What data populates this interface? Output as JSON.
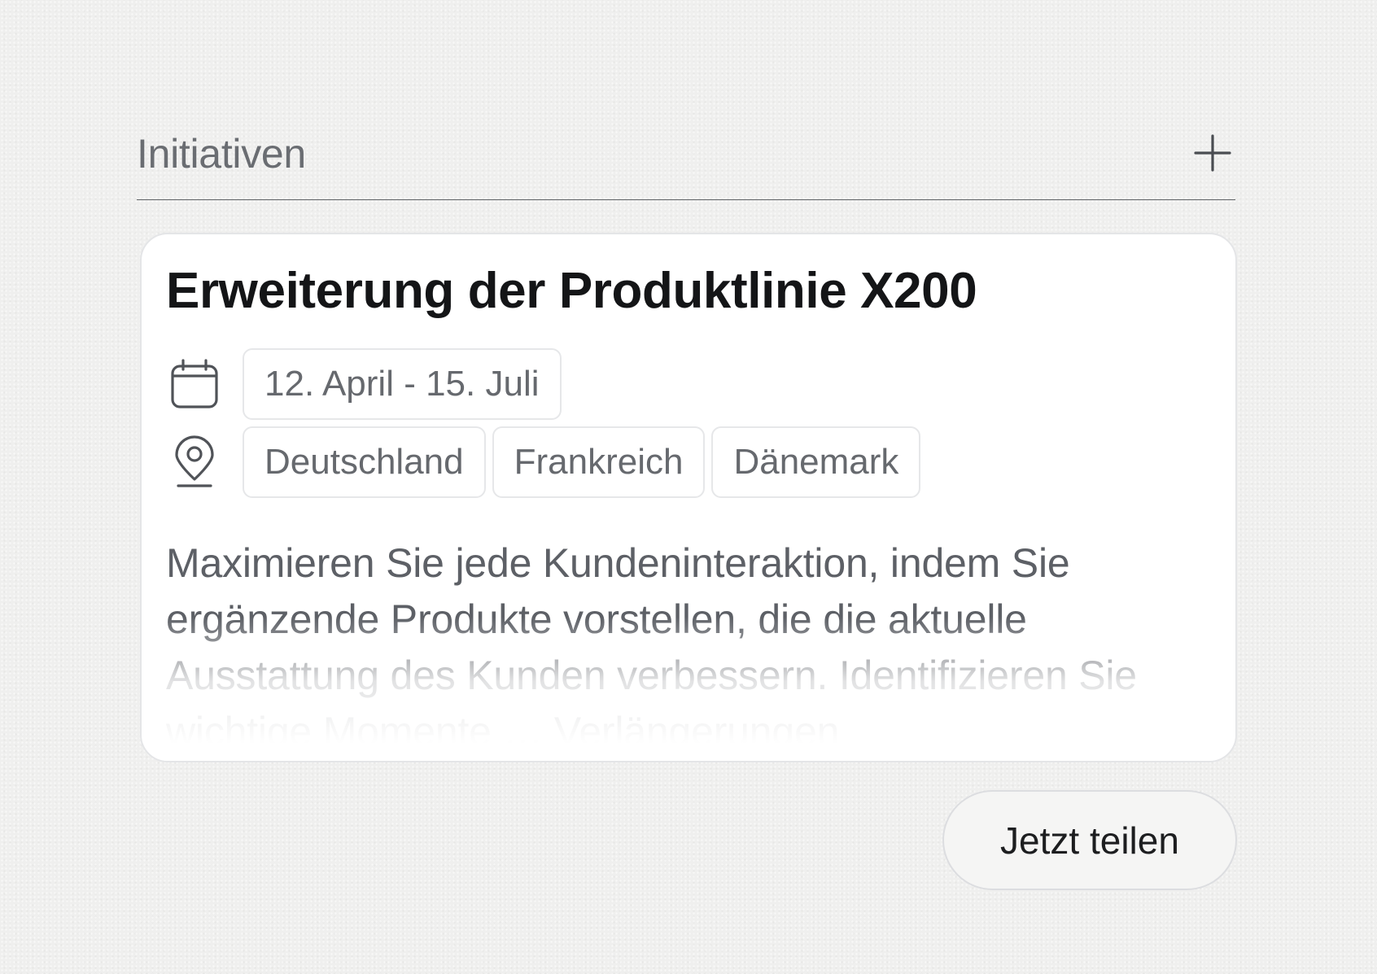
{
  "section": {
    "title": "Initiativen",
    "add_icon": "plus-icon"
  },
  "initiative": {
    "title": "Erweiterung der Produktlinie X200",
    "date_icon": "calendar-icon",
    "date_range": "12. April - 15. Juli",
    "location_icon": "map-pin-icon",
    "countries": [
      "Deutschland",
      "Frankreich",
      "Dänemark"
    ],
    "description": "Maximieren Sie jede Kundeninteraktion, indem Sie ergänzende Produkte vorstellen, die die aktuelle Ausstattung des Kunden verbessern. Identifizieren Sie wichtige Momente … Verlängerungen"
  },
  "actions": {
    "share_label": "Jetzt teilen"
  },
  "colors": {
    "background": "#efefee",
    "card": "#ffffff",
    "title_text": "#141517",
    "muted_text": "#66696e"
  }
}
